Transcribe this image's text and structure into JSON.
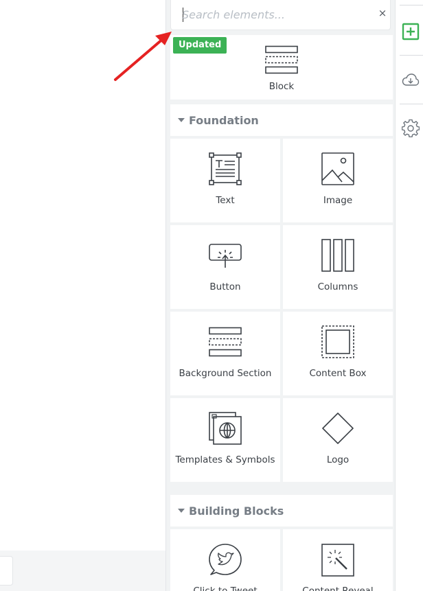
{
  "search": {
    "placeholder": "Search elements...",
    "value": "",
    "clear_glyph": "×"
  },
  "featured": {
    "badge": "Updated",
    "label": "Block",
    "icon": "block-icon"
  },
  "sections": [
    {
      "title": "Foundation",
      "items": [
        {
          "label": "Text",
          "icon": "text-icon"
        },
        {
          "label": "Image",
          "icon": "image-icon"
        },
        {
          "label": "Button",
          "icon": "button-icon"
        },
        {
          "label": "Columns",
          "icon": "columns-icon"
        },
        {
          "label": "Background Section",
          "icon": "background-section-icon"
        },
        {
          "label": "Content Box",
          "icon": "content-box-icon"
        },
        {
          "label": "Templates & Symbols",
          "icon": "templates-symbols-icon"
        },
        {
          "label": "Logo",
          "icon": "logo-icon"
        }
      ]
    },
    {
      "title": "Building Blocks",
      "items": [
        {
          "label": "Click to Tweet",
          "icon": "twitter-icon"
        },
        {
          "label": "Content Reveal",
          "icon": "magic-wand-icon"
        }
      ]
    }
  ],
  "rail": [
    {
      "name": "add-element",
      "icon": "plus-square-icon",
      "active": true
    },
    {
      "name": "cloud-templates",
      "icon": "cloud-download-icon",
      "active": false
    },
    {
      "name": "settings",
      "icon": "gear-icon",
      "active": false
    }
  ],
  "colors": {
    "accent": "#3cb255",
    "arrow": "#e52222",
    "icon_stroke": "#3a3f45",
    "section_title": "#767d85"
  }
}
